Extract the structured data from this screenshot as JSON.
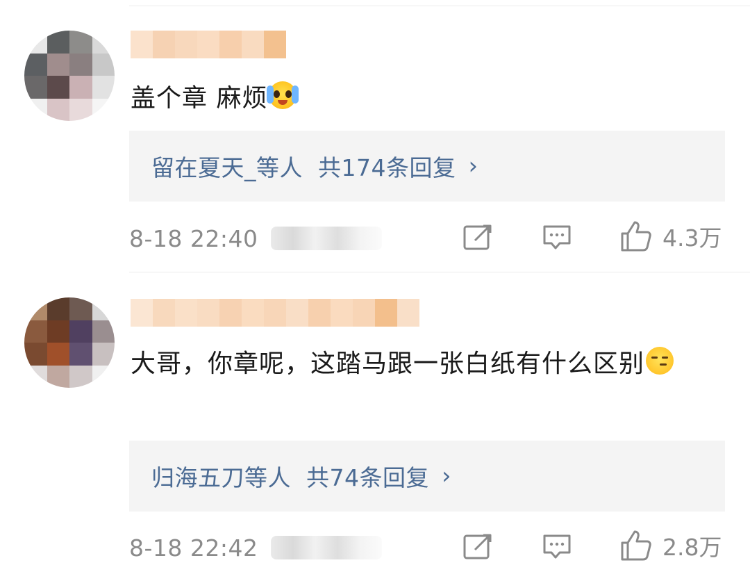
{
  "comments": [
    {
      "text": "盖个章 麻烦",
      "emoji": "crying-laughing-emoji",
      "reply_users": "留在夏天_等人",
      "reply_total": "共174条回复",
      "chevron": "›",
      "time": "8-18 22:40",
      "likes": "4.3万"
    },
    {
      "text": "大哥，你章呢，这踏马跟一张白纸有什么区别",
      "emoji": "speechless-emoji",
      "reply_users": "归海五刀等人",
      "reply_total": "共74条回复",
      "chevron": "›",
      "time": "8-18 22:42",
      "likes": "2.8万"
    }
  ],
  "icons": {
    "edit": "edit-icon",
    "reply": "comment-icon",
    "like": "thumbs-up-icon"
  },
  "colors": {
    "reply_link": "#4b6b94",
    "meta_text": "#8a8a8a",
    "reply_bg": "#f4f4f4"
  }
}
